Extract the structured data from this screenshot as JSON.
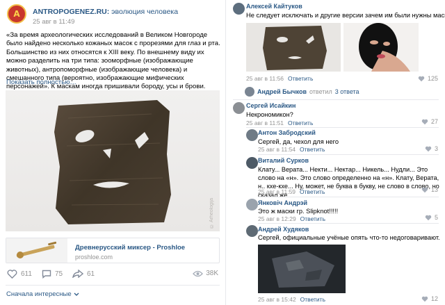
{
  "post": {
    "avatar_text": "A",
    "author_name": "ANTROPOGENEZ.RU:",
    "author_desc": "эволюция человека",
    "date": "25 авг в 11:49",
    "text": "«За время археологических исследований в Великом Новгороде было найдено несколько кожаных масок с прорезями для глаз и рта. Большинство из них относятся к XIII веку. По внешнему виду их можно разделить на три типа: зооморфные (изображающие животных), антропоморфные (изображающие человека) и смешанного типа (вероятно, изображающие мифических персонажей». К маскам иногда пришивали бороду, усы и брови.",
    "show_more": "Показать полностью…",
    "photo_credit": "© Arheologija",
    "link_card": {
      "title": "Древнерусский миксер - Proshloe",
      "domain": "proshloe.com"
    },
    "likes": "611",
    "comments_count": "75",
    "reposts": "61",
    "views": "38K",
    "sort_label": "Сначала интересные"
  },
  "comments": {
    "c1": {
      "name": "Алексей Кайтуков",
      "text": "Не следует исключать и другие версии зачем им были нужны маски",
      "date": "25 авг в 11:56",
      "reply": "Ответить",
      "likes": "125"
    },
    "thread": {
      "name": "Андрей Бычков",
      "verb": "ответил",
      "count": "3 ответа"
    },
    "c2": {
      "name": "Сергей Исайкин",
      "text": "Некрономикон?",
      "date": "25 авг в 11:51",
      "reply": "Ответить",
      "likes": "27"
    },
    "c3": {
      "name": "Антон Забродский",
      "text": "Сергей, да, чехол для него",
      "date": "25 авг в 11:54",
      "reply": "Ответить",
      "likes": "3"
    },
    "c4": {
      "name": "Виталий Сурков",
      "text": "Клату... Верата... Некти... Нектар... Никель... Нудли... Это слово на «н». Это слово определенно на «н». Клату, Верата, н.. кхе-кхе... Ну, может, не буква в букву, не слово в слово, но сказал же...",
      "date": "25 авг в 11:59",
      "reply": "Ответить",
      "likes": "13"
    },
    "c5": {
      "name": "Янковіч Андрэй",
      "text": "Это ж маски гр. Slipknot!!!!!",
      "date": "25 авг в 12:29",
      "reply": "Ответить",
      "likes": "5"
    },
    "c6": {
      "name": "Андрей Худяков",
      "text": "Сергей, официальные учёные опять что-то недоговаривают.",
      "date": "25 авг в 15:42",
      "reply": "Ответить",
      "likes": "12"
    }
  },
  "colors": {
    "link": "#2a5885",
    "meta": "#939393",
    "separator": "#e7e8ec",
    "brand_red": "#c8372d"
  },
  "icons": [
    "heart-icon",
    "comment-icon",
    "share-icon",
    "eye-icon",
    "chevron-down-icon",
    "fist-emoji-icon"
  ]
}
